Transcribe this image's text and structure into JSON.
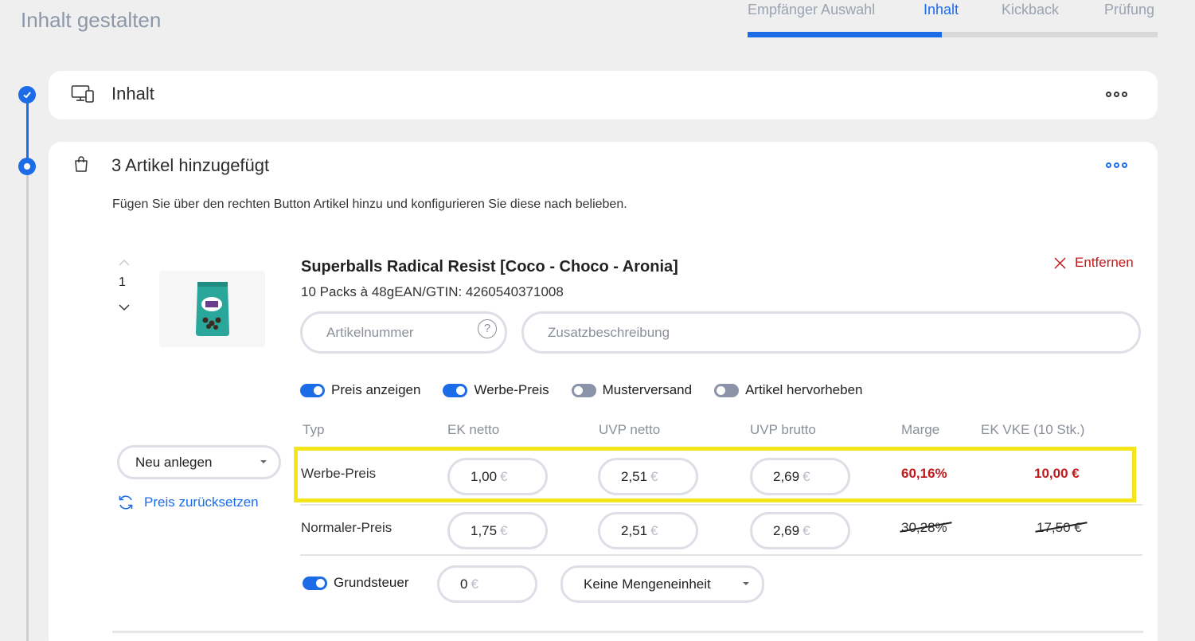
{
  "page": {
    "title": "Inhalt gestalten"
  },
  "steps": [
    {
      "label": "Empfänger Auswahl",
      "active": false
    },
    {
      "label": "Inhalt",
      "active": true
    },
    {
      "label": "Kickback",
      "active": false
    },
    {
      "label": "Prüfung",
      "active": false
    }
  ],
  "section_content": {
    "title": "Inhalt",
    "icon": "monitor-devices-icon"
  },
  "section_articles": {
    "title": "3 Artikel hinzugefügt",
    "icon": "shopping-bag-icon",
    "description": "Fügen Sie über den rechten Button Artikel hinzu und konfigurieren Sie diese nach belieben."
  },
  "article": {
    "position": "1",
    "name": "Superballs Radical Resist [Coco - Choco - Aronia]",
    "subtitle": "10 Packs à 48gEAN/GTIN: 4260540371008",
    "remove_label": "Entfernen",
    "article_number_placeholder": "Artikelnummer",
    "extra_description_placeholder": "Zusatzbeschreibung",
    "toggles": [
      {
        "label": "Preis anzeigen",
        "on": true
      },
      {
        "label": "Werbe-Preis",
        "on": true
      },
      {
        "label": "Musterversand",
        "on": false
      },
      {
        "label": "Artikel hervorheben",
        "on": false
      }
    ],
    "table_headers": [
      "Typ",
      "EK netto",
      "UVP netto",
      "UVP brutto",
      "Marge",
      "EK VKE (10 Stk.)"
    ],
    "rows": [
      {
        "type": "Werbe-Preis",
        "ek_netto": "1,00",
        "uvp_netto": "2,51",
        "uvp_brutto": "2,69",
        "marge": "60,16%",
        "ek_vke": "10,00 €"
      },
      {
        "type": "Normaler-Preis",
        "ek_netto": "1,75",
        "uvp_netto": "2,51",
        "uvp_brutto": "2,69",
        "marge": "30,28%",
        "ek_vke": "17,50 €"
      }
    ],
    "currency": "€",
    "create_new_label": "Neu anlegen",
    "reset_price_label": "Preis zurücksetzen",
    "grundsteuer_label": "Grundsteuer",
    "grundsteuer_on": true,
    "grundsteuer_value": "0",
    "unit_select": "Keine Mengeneinheit"
  },
  "colors": {
    "accent": "#1c6ce8",
    "danger": "#c01a1a",
    "highlight": "#f5e51c"
  }
}
